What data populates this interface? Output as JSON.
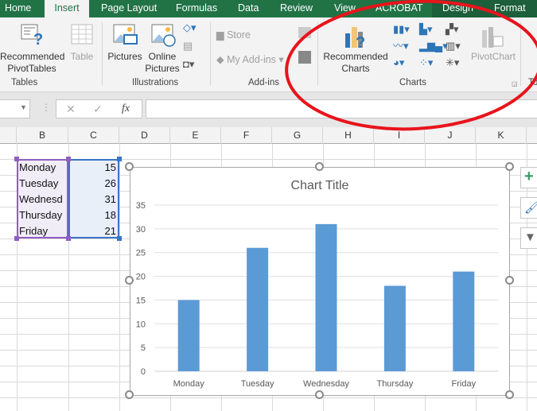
{
  "tabs": [
    "Home",
    "Insert",
    "Page Layout",
    "Formulas",
    "Data",
    "Review",
    "View",
    "ACROBAT",
    "Design",
    "Format"
  ],
  "active_tab": "Insert",
  "ribbon": {
    "tables": {
      "label": "Tables",
      "recommended_pivot_1": "Recommended",
      "recommended_pivot_2": "PivotTables",
      "table": "Table"
    },
    "illustrations": {
      "label": "Illustrations",
      "pictures": "Pictures",
      "online_1": "Online",
      "online_2": "Pictures"
    },
    "addins": {
      "label": "Add-ins",
      "store": "Store",
      "my_addins": "My Add-ins"
    },
    "charts": {
      "label": "Charts",
      "recommended_1": "Recommended",
      "recommended_2": "Charts",
      "pivotchart": "PivotChart"
    },
    "tours_partial": "To"
  },
  "formula_bar": {
    "fx": "fx",
    "cancel": "✕",
    "enter": "✓",
    "value": ""
  },
  "columns": [
    "B",
    "C",
    "D",
    "E",
    "F",
    "G",
    "H",
    "I",
    "J",
    "K"
  ],
  "cells": [
    {
      "label": "Monday",
      "value": "15"
    },
    {
      "label": "Tuesday",
      "value": "26"
    },
    {
      "label": "Wednesd",
      "value": "31"
    },
    {
      "label": "Thursday",
      "value": "18"
    },
    {
      "label": "Friday",
      "value": "21"
    }
  ],
  "chart_data": {
    "type": "bar",
    "title": "Chart Title",
    "categories": [
      "Monday",
      "Tuesday",
      "Wednesday",
      "Thursday",
      "Friday"
    ],
    "values": [
      15,
      26,
      31,
      18,
      21
    ],
    "ylim": [
      0,
      35
    ],
    "yticks": [
      "0",
      "5",
      "10",
      "15",
      "20",
      "25",
      "30",
      "35"
    ],
    "grid": true,
    "bar_color": "#5b9bd5"
  },
  "colors": {
    "ribbon_green": "#217346",
    "annotation_red": "#e8141c"
  }
}
